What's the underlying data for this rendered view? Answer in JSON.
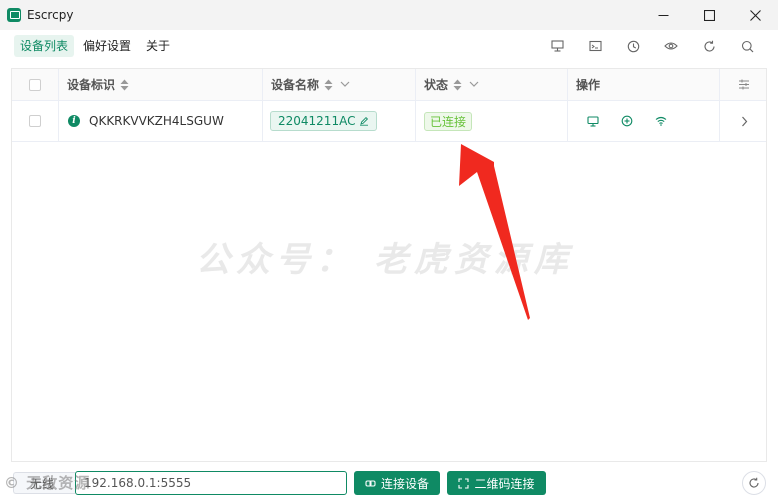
{
  "window": {
    "title": "Escrcpy",
    "minimize": "–",
    "maximize": "☐",
    "close": "✕"
  },
  "menu": {
    "tabs": [
      {
        "label": "设备列表",
        "active": true
      },
      {
        "label": "偏好设置",
        "active": false
      },
      {
        "label": "关于",
        "active": false
      }
    ],
    "icons": [
      "display-icon",
      "terminal-icon",
      "history-icon",
      "eye-icon",
      "refresh-icon",
      "search-icon"
    ]
  },
  "table": {
    "columns": [
      {
        "label": "设备标识"
      },
      {
        "label": "设备名称"
      },
      {
        "label": "状态"
      },
      {
        "label": "操作"
      }
    ],
    "rows": [
      {
        "serial": "QKKRKVVKZH4LSGUW",
        "name": "22041211AC",
        "status": "已连接"
      }
    ]
  },
  "watermark": "公众号： 老虎资源库",
  "bottom": {
    "mode_label": "无线",
    "address_value": "192.168.0.1:5555",
    "connect_button": "连接设备",
    "qr_button": "二维码连接"
  },
  "corner_watermark": "© 无敌资源",
  "colors": {
    "accent": "#0f8a64",
    "status_green": "#67c23a",
    "arrow_red": "#f0291f"
  }
}
